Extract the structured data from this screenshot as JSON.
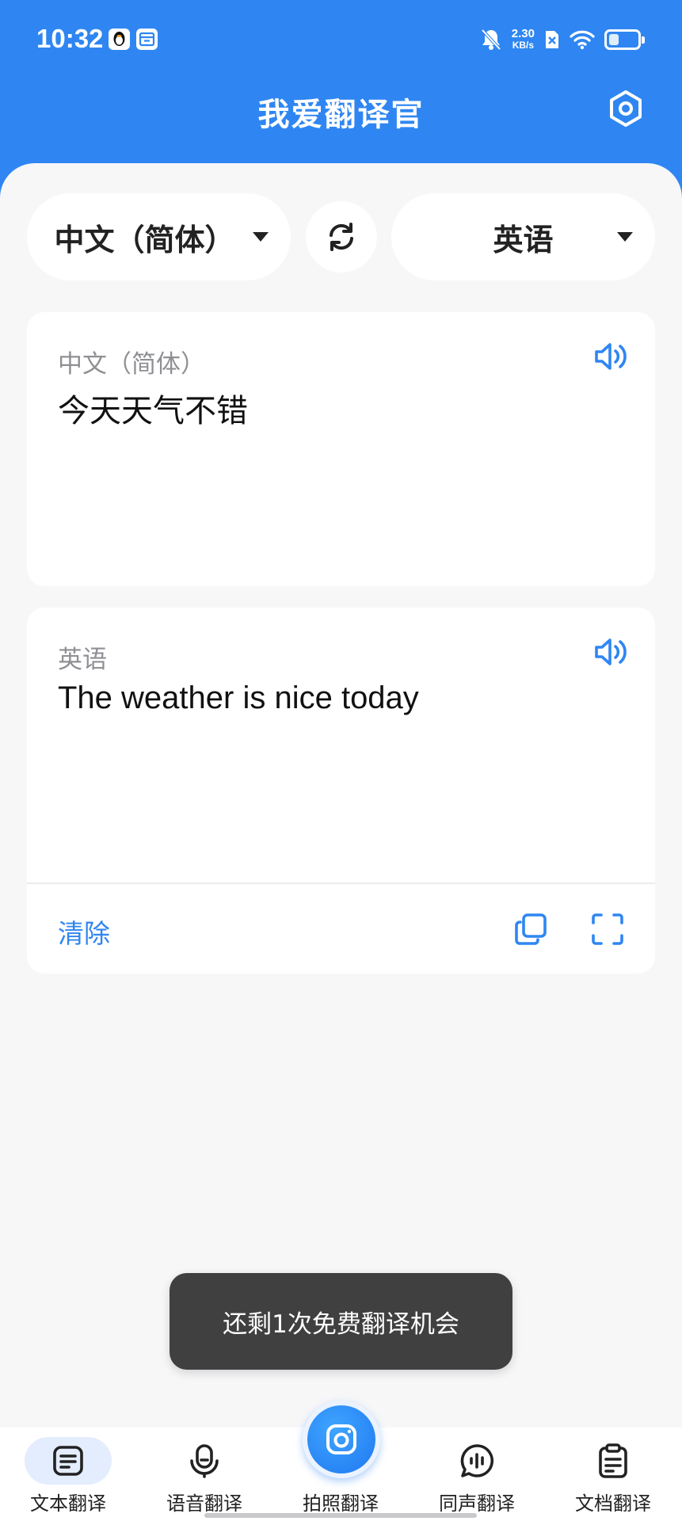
{
  "status_bar": {
    "time": "10:32",
    "net_speed_value": "2.30",
    "net_speed_unit": "KB/s",
    "battery_level": 0.35
  },
  "header": {
    "title": "我爱翻译官",
    "settings_icon": "gear-hexagon-icon"
  },
  "language_bar": {
    "source_lang": "中文（简体）",
    "target_lang": "英语",
    "swap_icon": "swap-arrows-icon"
  },
  "source_card": {
    "lang_label": "中文（简体）",
    "text": "今天天气不错"
  },
  "result_card": {
    "lang_label": "英语",
    "text": "The weather is nice today",
    "clear_label": "清除"
  },
  "toast": {
    "message": "还剩1次免费翻译机会"
  },
  "bottom_nav": {
    "items": [
      {
        "label": "文本翻译",
        "icon": "text-doc-icon",
        "active": true
      },
      {
        "label": "语音翻译",
        "icon": "microphone-icon",
        "active": false
      },
      {
        "label": "拍照翻译",
        "icon": "camera-icon",
        "active": false
      },
      {
        "label": "同声翻译",
        "icon": "voice-bubble-icon",
        "active": false
      },
      {
        "label": "文档翻译",
        "icon": "clipboard-doc-icon",
        "active": false
      }
    ]
  },
  "colors": {
    "primary": "#2f86f2",
    "background": "#f7f7f8",
    "toast_bg": "#404040"
  }
}
